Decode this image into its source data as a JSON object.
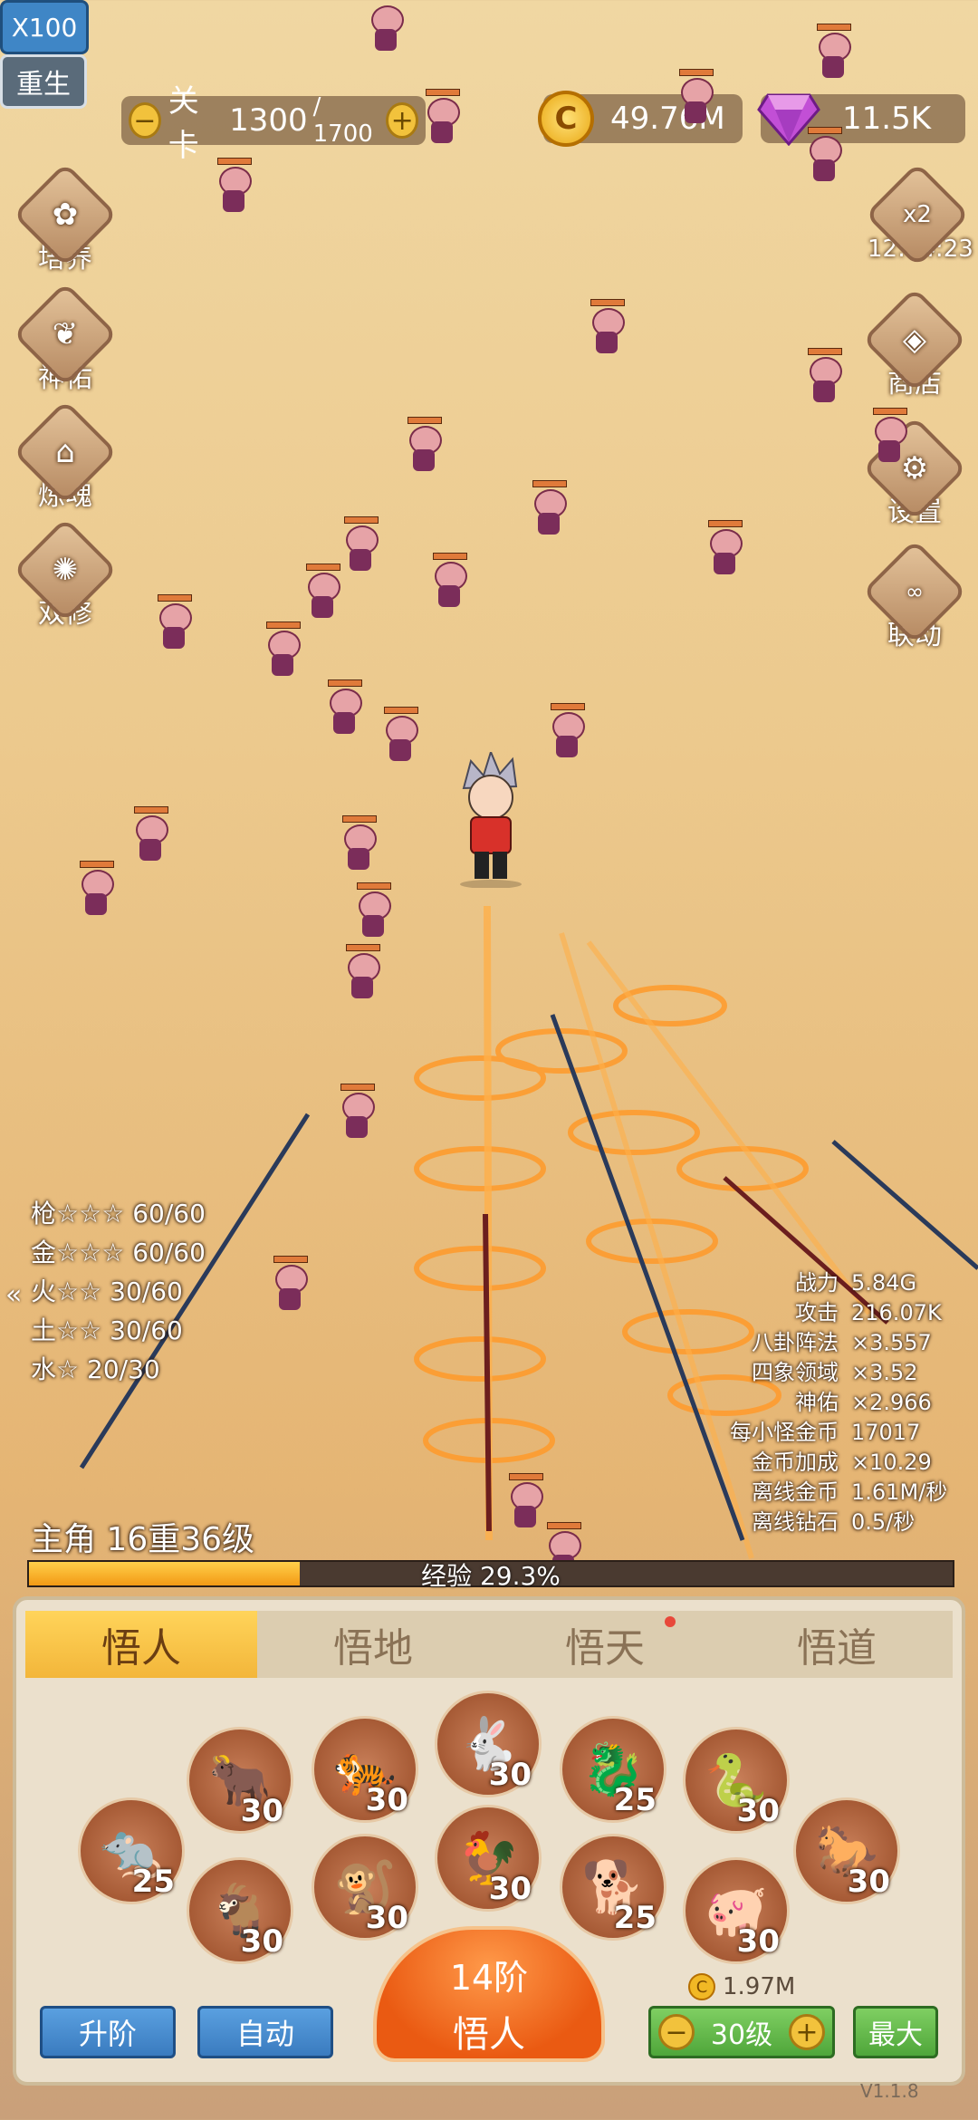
{
  "topbar": {
    "speed": "X100",
    "stage_label": "关卡",
    "stage_current": "1300",
    "stage_total": "/ 1700",
    "rebirth": "重生",
    "gold": "49.76M",
    "diamonds": "11.5K",
    "coin_symbol": "C"
  },
  "left_menu": [
    "培养",
    "神佑",
    "炼魂",
    "双修"
  ],
  "right_menu": {
    "boost_label": "x2",
    "boost_timer": "12:04:23",
    "shop": "商店",
    "settings": "设置",
    "link": "联动"
  },
  "elements": [
    {
      "name": "枪☆☆☆",
      "value": "60/60"
    },
    {
      "name": "金☆☆☆",
      "value": "60/60"
    },
    {
      "name": "火☆☆",
      "value": "30/60"
    },
    {
      "name": "土☆☆",
      "value": "30/60"
    },
    {
      "name": "水☆",
      "value": "20/30"
    }
  ],
  "stats": [
    {
      "label": "战力",
      "value": "5.84G"
    },
    {
      "label": "攻击",
      "value": "216.07K"
    },
    {
      "label": "八卦阵法",
      "value": "×3.557"
    },
    {
      "label": "四象领域",
      "value": "×3.52"
    },
    {
      "label": "神佑",
      "value": "×2.966"
    },
    {
      "label": "每小怪金币",
      "value": "17017"
    },
    {
      "label": "金币加成",
      "value": "×10.29"
    },
    {
      "label": "离线金币",
      "value": "1.61M/秒"
    },
    {
      "label": "离线钻石",
      "value": "0.5/秒"
    }
  ],
  "hero": {
    "level_text": "主角 16重36级",
    "exp_text": "经验 29.3%",
    "exp_fraction": 0.293
  },
  "tabs": [
    "悟人",
    "悟地",
    "悟天",
    "悟道"
  ],
  "zodiac_levels": [
    "25",
    "30",
    "30",
    "30",
    "25",
    "30",
    "30",
    "30",
    "30",
    "30",
    "25",
    "30"
  ],
  "bottom": {
    "upgrade": "升阶",
    "auto": "自动",
    "tier_line1": "14阶",
    "tier_line2": "悟人",
    "cost": "1.97M",
    "level": "30级",
    "max": "最大",
    "version": "V1.1.8"
  }
}
